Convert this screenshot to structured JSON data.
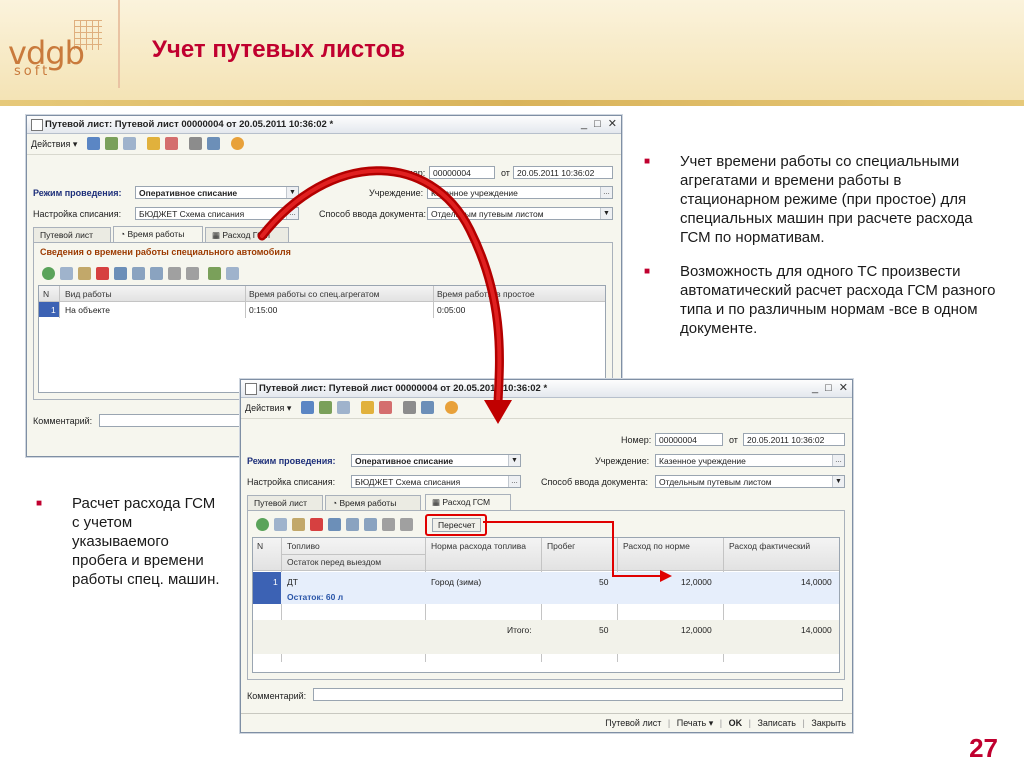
{
  "slide": {
    "title": "Учет путевых листов",
    "page_number": "27",
    "logo_text": "vdgb",
    "logo_sub": "soft"
  },
  "bullets": {
    "right_1": "Учет времени работы со специальными агрегатами и времени работы в стационарном режиме (при простое) для специальных машин при расчете расхода ГСМ по нормативам.",
    "right_2": "Возможность для одного ТС произвести автоматический расчет расхода ГСМ разного типа и по различным нормам -все в одном документе.",
    "left_1": "Расчет расхода ГСМ с учетом указываемого пробега и времени работы спец. машин."
  },
  "accent_color": "#c0002f",
  "window1": {
    "title": "Путевой лист: Путевой лист 00000004 от 20.05.2011 10:36:02 *",
    "actions": "Действия ▾",
    "number_label": "Номер:",
    "number": "00000004",
    "date_label": "от",
    "date": "20.05.2011 10:36:02",
    "mode_label": "Режим проведения:",
    "mode_value": "Оперативное списание",
    "org_label": "Учреждение:",
    "org_value": "Казенное учреждение",
    "setting_label": "Настройка списания:",
    "setting_value": "БЮДЖЕТ Схема списания",
    "method_label": "Способ ввода документа:",
    "method_value": "Отдельным путевым листом",
    "tabs": [
      "Путевой лист",
      "Время работы",
      "Расход ГСМ"
    ],
    "section_title": "Сведения о времени работы специального автомобиля",
    "columns": [
      "N",
      "Вид работы",
      "Время работы со спец.агрегатом",
      "Время работы в простое"
    ],
    "row": {
      "n": "1",
      "work": "На объекте",
      "time_agg": "0:15:00",
      "time_idle": "0:05:00"
    },
    "comment_label": "Комментарий:"
  },
  "window2": {
    "title": "Путевой лист: Путевой лист 00000004 от 20.05.2011 10:36:02 *",
    "actions": "Действия ▾",
    "number_label": "Номер:",
    "number": "00000004",
    "date_label": "от",
    "date": "20.05.2011 10:36:02",
    "mode_label": "Режим проведения:",
    "mode_value": "Оперативное списание",
    "org_label": "Учреждение:",
    "org_value": "Казенное учреждение",
    "setting_label": "Настройка списания:",
    "setting_value": "БЮДЖЕТ Схема списания",
    "method_label": "Способ ввода документа:",
    "method_value": "Отдельным путевым листом",
    "tabs": [
      "Путевой лист",
      "Время работы",
      "Расход ГСМ"
    ],
    "recalc_button": "Пересчет",
    "columns": [
      "N",
      "Топливо",
      "Остаток перед выездом",
      "Норма расхода топлива",
      "Пробег",
      "Расход по норме",
      "Расход фактический"
    ],
    "row": {
      "n": "1",
      "fuel": "ДТ",
      "remain": "Остаток: 60 л",
      "norm": "Город (зима)",
      "mileage": "50",
      "by_norm": "12,0000",
      "actual": "14,0000"
    },
    "total_label": "Итого:",
    "total_mileage": "50",
    "total_by_norm": "12,0000",
    "total_actual": "14,0000",
    "comment_label": "Комментарий:",
    "footer_buttons": [
      "Путевой лист",
      "Печать ▾",
      "OK",
      "Записать",
      "Закрыть"
    ]
  }
}
